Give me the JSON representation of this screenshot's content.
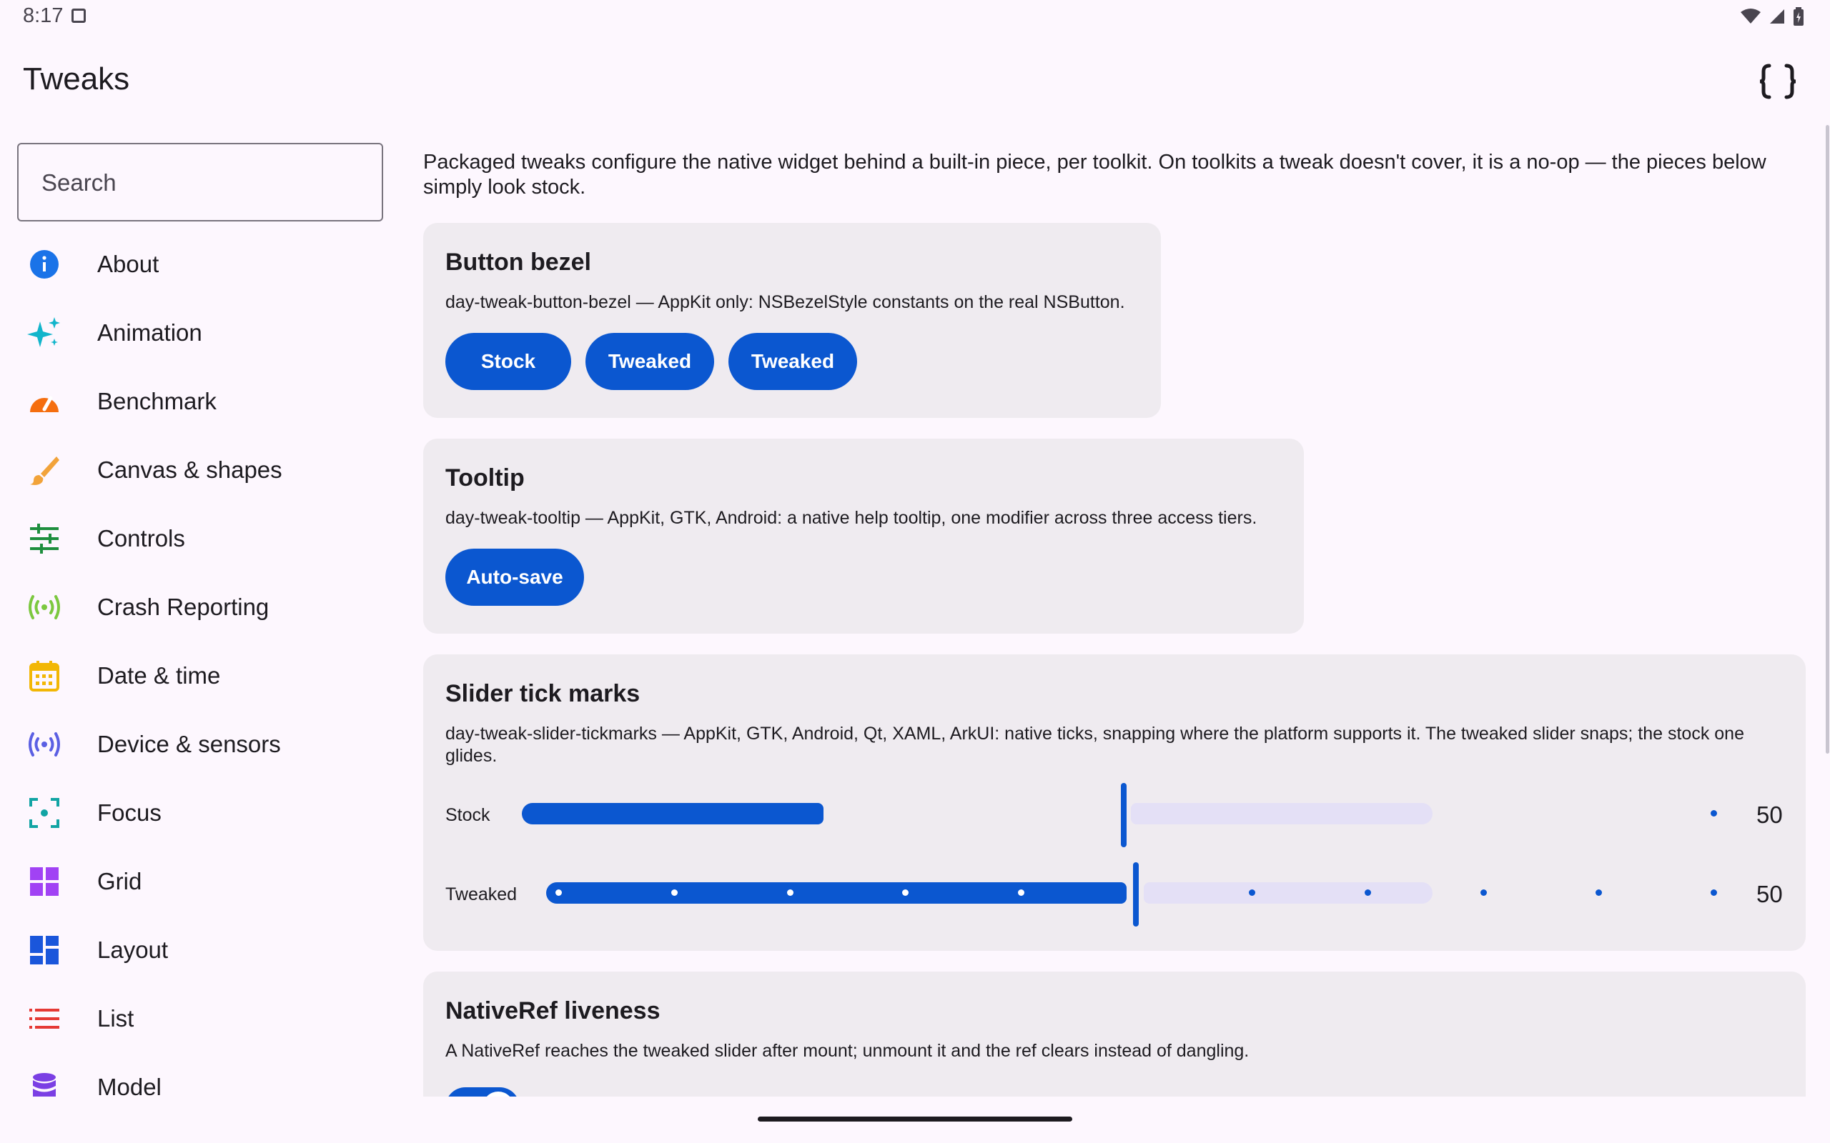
{
  "status_bar": {
    "time": "8:17"
  },
  "header": {
    "title": "Tweaks"
  },
  "search": {
    "placeholder": "Search"
  },
  "sidebar": {
    "items": [
      {
        "label": "About",
        "icon": "info-icon",
        "color": "#1a73e8"
      },
      {
        "label": "Animation",
        "icon": "sparkle-icon",
        "color": "#12b5cb"
      },
      {
        "label": "Benchmark",
        "icon": "speedometer-icon",
        "color": "#f56e0f"
      },
      {
        "label": "Canvas & shapes",
        "icon": "brush-icon",
        "color": "#f2a33a"
      },
      {
        "label": "Controls",
        "icon": "sliders-icon",
        "color": "#1e8e3e"
      },
      {
        "label": "Crash Reporting",
        "icon": "broadcast-icon",
        "color": "#7cc83f"
      },
      {
        "label": "Date & time",
        "icon": "calendar-icon",
        "color": "#f2b705"
      },
      {
        "label": "Device & sensors",
        "icon": "sensors-icon",
        "color": "#5b5fe3"
      },
      {
        "label": "Focus",
        "icon": "focus-icon",
        "color": "#12a4a4"
      },
      {
        "label": "Grid",
        "icon": "grid-icon",
        "color": "#a142f4"
      },
      {
        "label": "Layout",
        "icon": "layout-icon",
        "color": "#1a56db"
      },
      {
        "label": "List",
        "icon": "list-icon",
        "color": "#e53935"
      },
      {
        "label": "Model",
        "icon": "database-icon",
        "color": "#7b3fe4"
      }
    ]
  },
  "main": {
    "intro": "Packaged tweaks configure the native widget behind a built-in piece, per toolkit. On toolkits a tweak doesn't cover, it is a no-op — the pieces below simply look stock.",
    "cards": {
      "bezel": {
        "title": "Button bezel",
        "description": "day-tweak-button-bezel — AppKit only: NSBezelStyle constants on the real NSButton.",
        "buttons": [
          "Stock",
          "Tweaked",
          "Tweaked"
        ]
      },
      "tooltip": {
        "title": "Tooltip",
        "description": "day-tweak-tooltip — AppKit, GTK, Android: a native help tooltip, one modifier across three access tiers.",
        "button": "Auto-save"
      },
      "slider": {
        "title": "Slider tick marks",
        "description": "day-tweak-slider-tickmarks — AppKit, GTK, Android, Qt, XAML, ArkUI: native ticks, snapping where the platform supports it. The tweaked slider snaps; the stock one glides.",
        "rows": [
          {
            "label": "Stock",
            "value": "50"
          },
          {
            "label": "Tweaked",
            "value": "50"
          }
        ]
      },
      "nativeref": {
        "title": "NativeRef liveness",
        "description": "A NativeRef reaches the tweaked slider after mount; unmount it and the ref clears instead of dangling."
      }
    }
  },
  "colors": {
    "accent": "#0b57d0",
    "card": "#efebf0",
    "background": "#fdf7fe"
  }
}
